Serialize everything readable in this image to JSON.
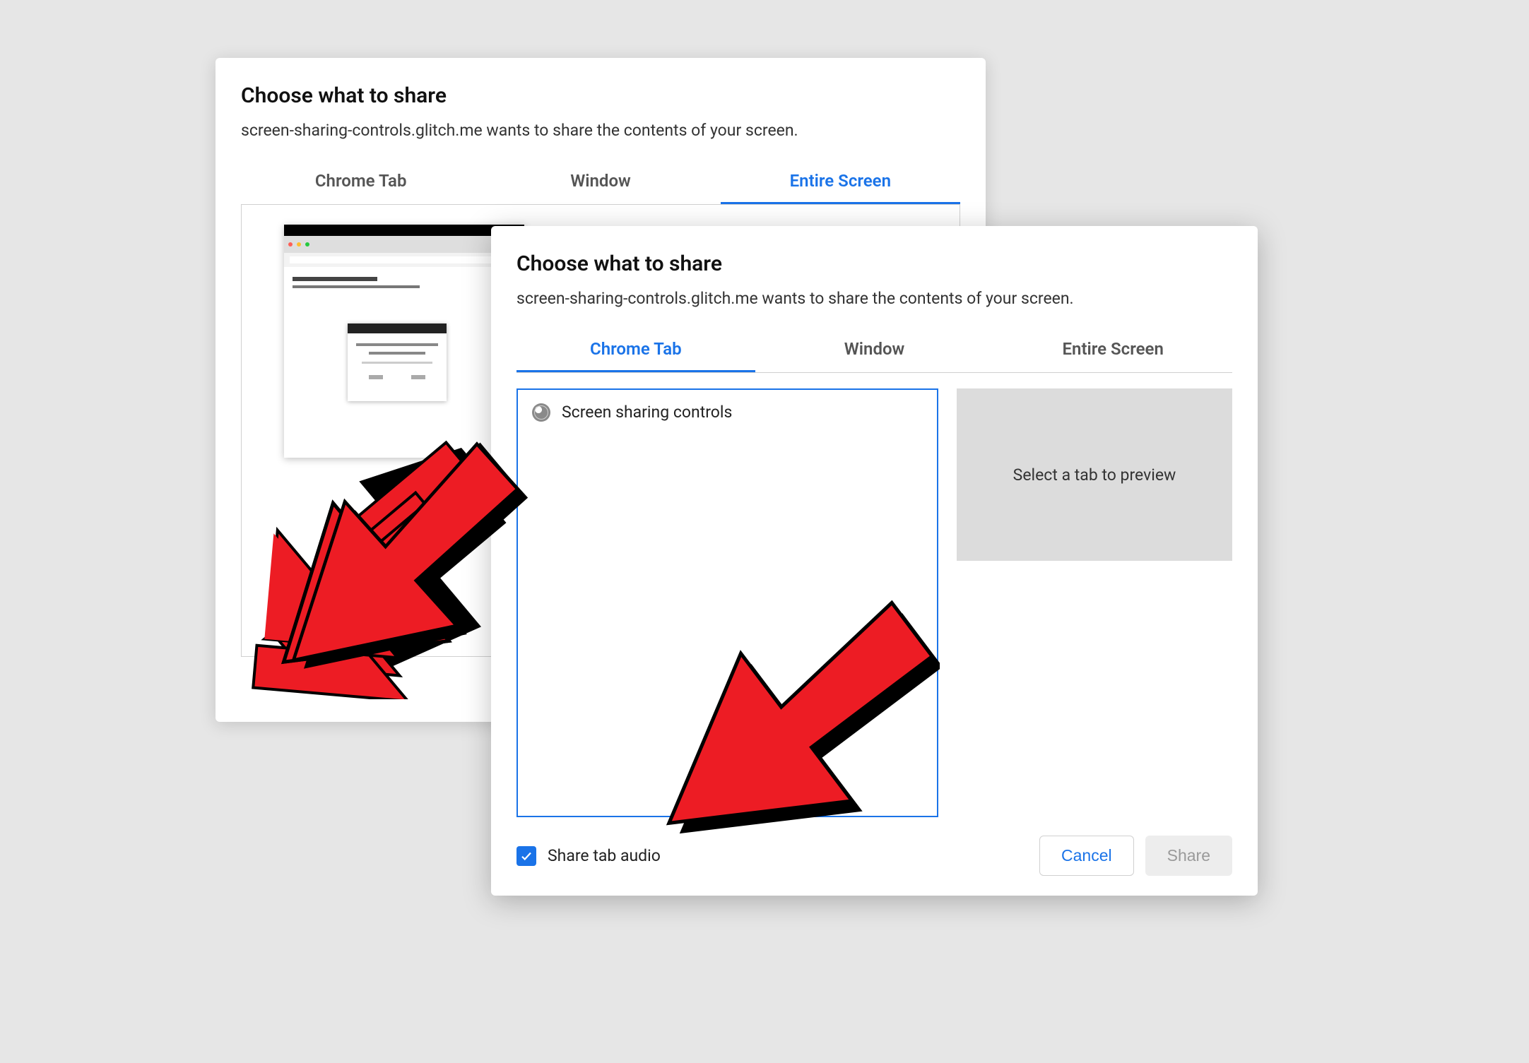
{
  "back_dialog": {
    "title": "Choose what to share",
    "subtitle": "screen-sharing-controls.glitch.me wants to share the contents of your screen.",
    "tabs": [
      "Chrome Tab",
      "Window",
      "Entire Screen"
    ],
    "active_tab_index": 2
  },
  "front_dialog": {
    "title": "Choose what to share",
    "subtitle": "screen-sharing-controls.glitch.me wants to share the contents of your screen.",
    "tabs": [
      "Chrome Tab",
      "Window",
      "Entire Screen"
    ],
    "active_tab_index": 0,
    "tab_items": [
      {
        "icon": "globe-icon",
        "label": "Screen sharing controls"
      }
    ],
    "preview_placeholder": "Select a tab to preview",
    "share_audio_label": "Share tab audio",
    "share_audio_checked": true,
    "cancel_label": "Cancel",
    "share_label": "Share"
  },
  "colors": {
    "accent": "#1a73e8",
    "arrow_fill": "#ed1c24",
    "arrow_shadow": "#000000"
  }
}
